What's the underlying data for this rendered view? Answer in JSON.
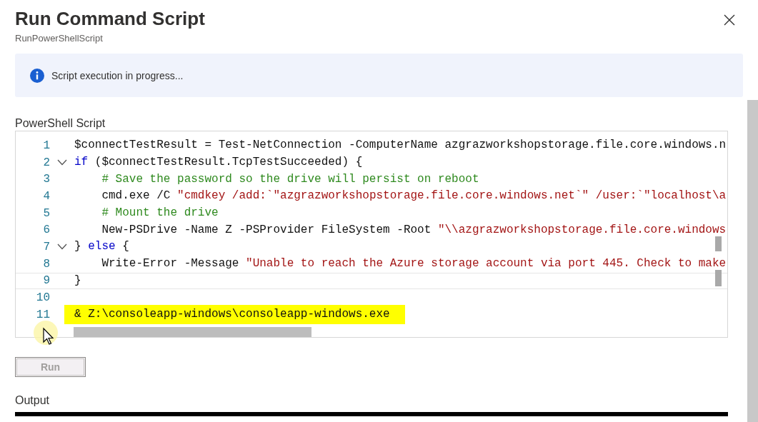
{
  "panel": {
    "title": "Run Command Script",
    "subtitle": "RunPowerShellScript"
  },
  "info": {
    "message": "Script execution in progress..."
  },
  "editor": {
    "label": "PowerShell Script",
    "lines": [
      {
        "number": "1",
        "foldable": false,
        "highlighted": false,
        "current": false,
        "tokens": [
          {
            "kind": "plain",
            "text": "$connectTestResult = Test-NetConnection -ComputerName azgrazworkshopstorage.file.core.windows.n"
          }
        ]
      },
      {
        "number": "2",
        "foldable": true,
        "highlighted": false,
        "current": false,
        "tokens": [
          {
            "kind": "keyword",
            "text": "if"
          },
          {
            "kind": "plain",
            "text": " ($connectTestResult.TcpTestSucceeded) {"
          }
        ]
      },
      {
        "number": "3",
        "foldable": false,
        "highlighted": false,
        "current": false,
        "tokens": [
          {
            "kind": "comment",
            "text": "    # Save the password so the drive will persist on reboot"
          }
        ]
      },
      {
        "number": "4",
        "foldable": false,
        "highlighted": false,
        "current": false,
        "tokens": [
          {
            "kind": "plain",
            "text": "    cmd.exe /C "
          },
          {
            "kind": "string",
            "text": "\"cmdkey /add:`\"azgrazworkshopstorage.file.core.windows.net`\" /user:`\"localhost\\a"
          }
        ]
      },
      {
        "number": "5",
        "foldable": false,
        "highlighted": false,
        "current": false,
        "tokens": [
          {
            "kind": "comment",
            "text": "    # Mount the drive"
          }
        ]
      },
      {
        "number": "6",
        "foldable": false,
        "highlighted": false,
        "current": false,
        "tokens": [
          {
            "kind": "plain",
            "text": "    New-PSDrive -Name Z -PSProvider FileSystem -Root "
          },
          {
            "kind": "string",
            "text": "\"\\\\azgrazworkshopstorage.file.core.windows"
          }
        ]
      },
      {
        "number": "7",
        "foldable": true,
        "highlighted": false,
        "current": false,
        "tokens": [
          {
            "kind": "plain",
            "text": "} "
          },
          {
            "kind": "keyword",
            "text": "else"
          },
          {
            "kind": "plain",
            "text": " {"
          }
        ]
      },
      {
        "number": "8",
        "foldable": false,
        "highlighted": false,
        "current": false,
        "tokens": [
          {
            "kind": "plain",
            "text": "    Write-Error -Message "
          },
          {
            "kind": "string",
            "text": "\"Unable to reach the Azure storage account via port 445. Check to make"
          }
        ]
      },
      {
        "number": "9",
        "foldable": false,
        "highlighted": false,
        "current": true,
        "tokens": [
          {
            "kind": "plain",
            "text": "}"
          }
        ]
      },
      {
        "number": "10",
        "foldable": false,
        "current": false
      },
      {
        "number": "11",
        "foldable": false,
        "highlighted": true,
        "current": false,
        "tokens": [
          {
            "kind": "plain",
            "text": "& Z:\\consoleapp-windows\\consoleapp-windows.exe"
          }
        ]
      }
    ]
  },
  "run_button": {
    "label": "Run",
    "disabled": true
  },
  "output": {
    "label": "Output"
  }
}
